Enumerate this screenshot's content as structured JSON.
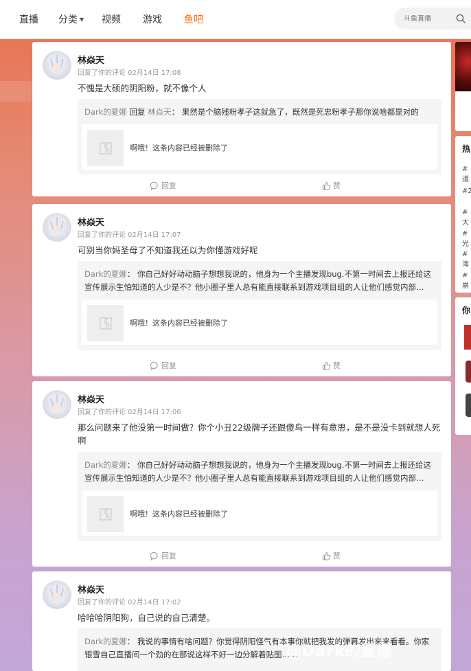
{
  "nav": {
    "items": [
      {
        "label": "直播"
      },
      {
        "label": "分类"
      },
      {
        "label": "视频"
      },
      {
        "label": "游戏"
      },
      {
        "label": "鱼吧"
      }
    ],
    "search_placeholder": "斗鱼直播"
  },
  "comments": [
    {
      "username": "林焱天",
      "meta": "回复了你的评论 02月14日 17:08",
      "text": "不愧是大硕的阴阳粉，就不像个人",
      "quote_user": "Dark的夏娜",
      "quote_reply_word": " 回复 ",
      "quote_target": "林焱天",
      "quote_text": "： 果然是个脑残粉孝子这就急了，既然是死忠粉孝子那你说啥都是对的",
      "deleted_text": "啊哦！这条内容已经被删除了",
      "reply_label": "回复",
      "like_label": "赞"
    },
    {
      "username": "林焱天",
      "meta": "回复了你的评论 02月14日 17:07",
      "text": "可别当你妈圣母了不知道我还以为你懂游戏好呢",
      "quote_user": "Dark的夏娜",
      "quote_text": "： 你自己好好动动脑子想想我说的，他身为一个主播发现bug.不第一时间去上报还给这宣传展示生怕知道的人少是不？他小圈子里人总有能直接联系到游戏项目组的人让他们感觉内部…",
      "deleted_text": "啊哦！这条内容已经被删除了",
      "reply_label": "回复",
      "like_label": "赞"
    },
    {
      "username": "林焱天",
      "meta": "回复了你的评论 02月14日 17:06",
      "text": "那么问题来了他没第一时间做？你个小丑22级牌子还跟傻鸟一样有意思，是不是没卡到就想人死啊",
      "quote_user": "Dark的夏娜",
      "quote_text": "： 你自己好好动动脑子想想我说的，他身为一个主播发现bug.不第一时间去上报还给这宣传展示生怕知道的人少是不？他小圈子里人总有能直接联系到游戏项目组的人让他们感觉内部…",
      "deleted_text": "啊哦！这条内容已经被删除了",
      "reply_label": "回复",
      "like_label": "赞"
    },
    {
      "username": "林焱天",
      "meta": "回复了你的评论 02月14日 17:02",
      "text": "哈哈哈阴阳狗，自己说的自己清楚。",
      "quote_user": "Dark的夏娜",
      "quote_text": "： 我说的事情有啥问题？你觉得阴阳怪气有本事你就把我发的弹幕发出来来看看。你家银雪自己直播间一个劲的在那说这样不好一边分解着贴图……"
    }
  ],
  "sidebar": {
    "hot_heading": "热",
    "tags": [
      "#道",
      "#2",
      "#大",
      "#光",
      "#海",
      "#崩"
    ],
    "you_heading": "你"
  },
  "watermark": "@Dark的夏娜",
  "colors": {
    "accent": "#ff6a00",
    "bg_top": "#e8704e",
    "bg_bottom": "#c2a6d9"
  }
}
